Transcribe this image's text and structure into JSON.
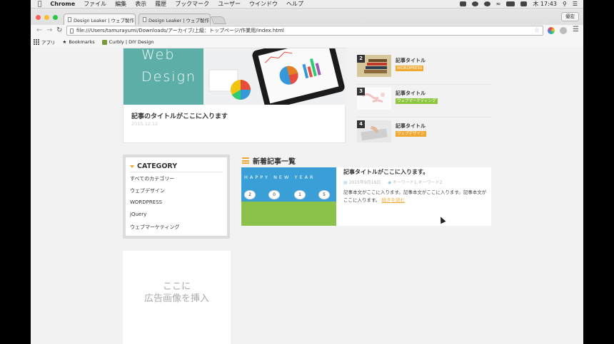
{
  "menubar": {
    "app": "Chrome",
    "items": [
      "ファイル",
      "編集",
      "表示",
      "履歴",
      "ブックマーク",
      "ユーザー",
      "ウインドウ",
      "ヘルプ"
    ],
    "clock": "木 17:43"
  },
  "browser": {
    "tabs": [
      {
        "label": "Design Leaker | ウェブ製作"
      },
      {
        "label": "Design Leaker | ウェブ製作"
      }
    ],
    "profile_button": "優宏",
    "url": "file:///Users/tamurayumi/Downloads/アーカイブ/上級：トップページ/作業用/index.html",
    "bookmarks": [
      "アプリ",
      "Bookmarks",
      "Curbly | DIY Design"
    ]
  },
  "hero": {
    "image_text_1": "Web",
    "image_text_2": "Design",
    "title": "記事のタイトルがここに入ります",
    "date": "2015.12.12"
  },
  "side_articles": [
    {
      "num": "2",
      "title": "記事タイトル",
      "badge": "WORDPRESS",
      "badge_color": "#f0a830"
    },
    {
      "num": "3",
      "title": "記事タイトル",
      "badge": "ウェブマーケティング",
      "badge_color": "#8dc63f"
    },
    {
      "num": "4",
      "title": "記事タイトル",
      "badge": "ウェブデザイン",
      "badge_color": "#f0a830"
    }
  ],
  "category": {
    "heading": "CATEGORY",
    "items": [
      "すべてのカテゴリー",
      "ウェブデザイン",
      "WORDPRESS",
      "jQuery",
      "ウェブマーケティング"
    ]
  },
  "ad": {
    "line1": "ここに",
    "line2": "広告画像を挿入"
  },
  "news": {
    "heading": "新着記事一覧",
    "image_text": "HAPPY NEW YEAR",
    "digits": [
      "2",
      "0",
      "1",
      "5"
    ],
    "title": "記事タイトルがここに入ります。",
    "date": "2015年9月18日",
    "tags": "キーワード1,キーワード2",
    "body": "記事本文がここに入ります。記事本文がここに入ります。記事本文がここに入ります。",
    "more": "続きを読む"
  },
  "colors": {
    "accent": "#f0a830",
    "teal": "#5eaea8"
  }
}
